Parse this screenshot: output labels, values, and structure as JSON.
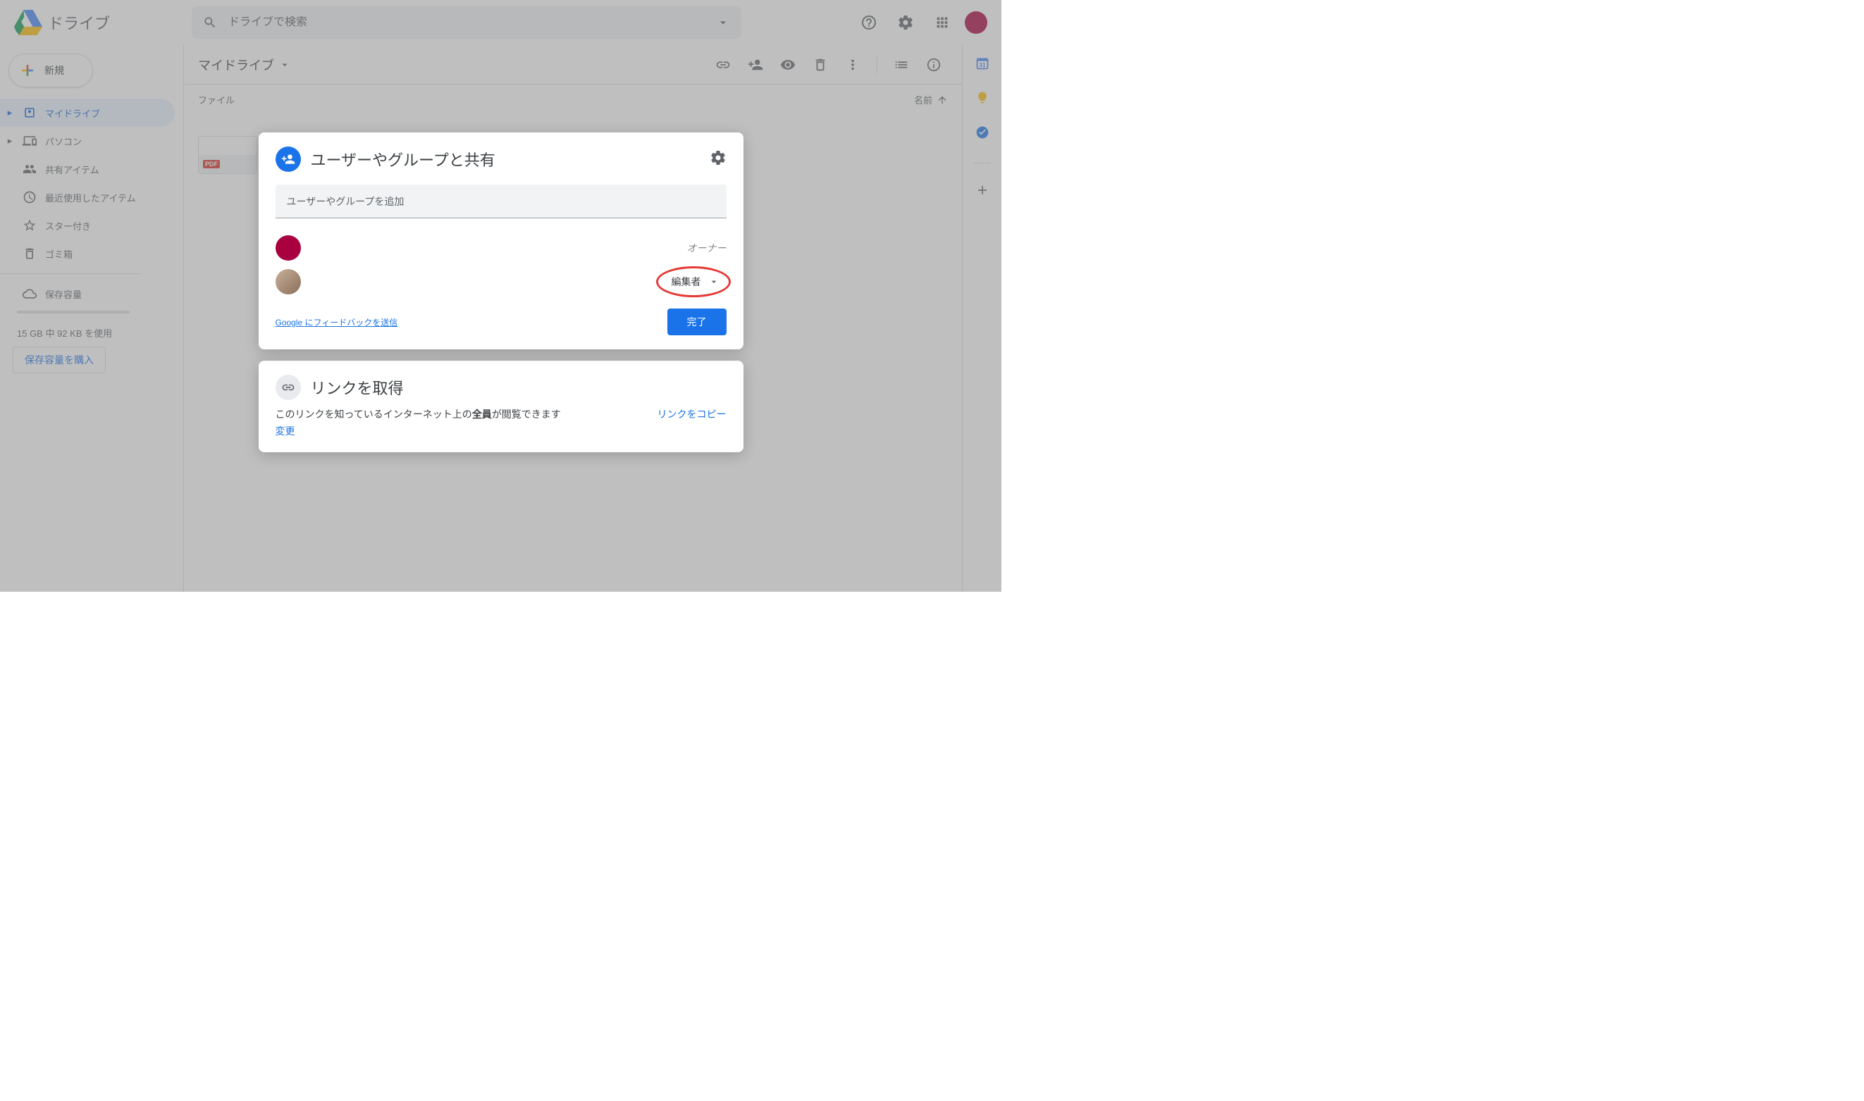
{
  "app": {
    "name": "ドライブ"
  },
  "search": {
    "placeholder": "ドライブで検索"
  },
  "newButton": "新規",
  "sidebar": {
    "items": [
      {
        "label": "マイドライブ"
      },
      {
        "label": "パソコン"
      },
      {
        "label": "共有アイテム"
      },
      {
        "label": "最近使用したアイテム"
      },
      {
        "label": "スター付き"
      },
      {
        "label": "ゴミ箱"
      }
    ],
    "storageLabel": "保存容量",
    "storageUsage": "15 GB 中 92 KB を使用",
    "buyStorage": "保存容量を購入"
  },
  "toolbar": {
    "breadcrumb": "マイドライブ"
  },
  "list": {
    "filesHeading": "ファイル",
    "nameCol": "名前",
    "pdfBadge": "PDF"
  },
  "shareDialog": {
    "title": "ユーザーやグループと共有",
    "addPlaceholder": "ユーザーやグループを追加",
    "ownerLabel": "オーナー",
    "roleLabel": "編集者",
    "feedback": "Google にフィードバックを送信",
    "done": "完了"
  },
  "linkDialog": {
    "title": "リンクを取得",
    "descPrefix": "このリンクを知っているインターネット上の",
    "descBold": "全員",
    "descSuffix": "が閲覧できます",
    "change": "変更",
    "copy": "リンクをコピー"
  }
}
